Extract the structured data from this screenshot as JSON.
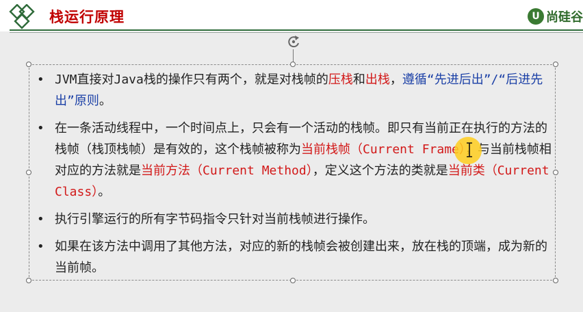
{
  "header": {
    "title": "栈运行原理",
    "brand_badge": "U",
    "brand_text": "尚硅谷"
  },
  "colors": {
    "title_red": "#c00000",
    "highlight_red": "#d21919",
    "highlight_blue": "#1a3fa6",
    "rule_green": "#2f6b3a"
  },
  "icons": {
    "logo": "diamond-logo-icon",
    "rotate": "rotate-handle-icon",
    "cursor": "text-cursor-icon"
  },
  "bullets": [
    {
      "parts": [
        {
          "t": "JVM直接对Java栈的操作只有两个，就是对栈帧的"
        },
        {
          "t": "压栈",
          "c": "red"
        },
        {
          "t": "和"
        },
        {
          "t": "出栈",
          "c": "red"
        },
        {
          "t": "，"
        },
        {
          "t": "遵循“先进后出”/“后进先出”原则",
          "c": "blue"
        },
        {
          "t": "。"
        }
      ]
    },
    {
      "parts": [
        {
          "t": "在一条活动线程中，一个时间点上，只会有一个活动的栈帧。即只有当前正在执行的方法的栈帧（栈顶栈帧）是有效的，这个栈帧被称为"
        },
        {
          "t": "当前栈帧（Current Frame）",
          "c": "red"
        },
        {
          "t": "，与当前栈帧相对应的方法就是"
        },
        {
          "t": "当前方法（Current Method）",
          "c": "red"
        },
        {
          "t": "，定义这个方法的类就是"
        },
        {
          "t": "当前类（Current Class）",
          "c": "red"
        },
        {
          "t": "。"
        }
      ]
    },
    {
      "parts": [
        {
          "t": "执行引擎运行的所有字节码指令只针对当前栈帧进行操作。"
        }
      ]
    },
    {
      "parts": [
        {
          "t": "如果在该方法中调用了其他方法，对应的新的栈帧会被创建出来，放在栈的顶端，成为新的当前帧。"
        }
      ]
    }
  ]
}
